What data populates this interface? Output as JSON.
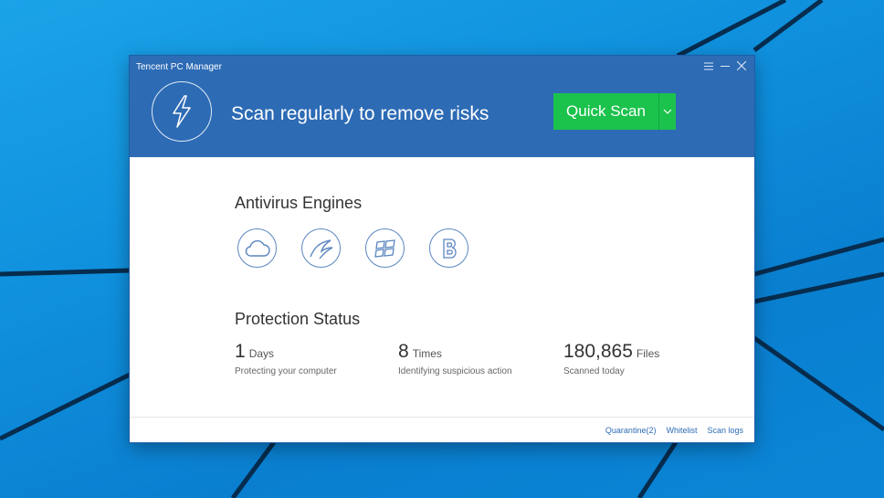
{
  "window": {
    "title": "Tencent PC Manager",
    "controls": [
      "menu-icon",
      "minimize-icon",
      "close-icon"
    ]
  },
  "header": {
    "icon": "lightning-bolt-icon",
    "tagline": "Scan regularly to remove risks",
    "scan_button": "Quick Scan"
  },
  "engines": {
    "title": "Antivirus Engines",
    "items": [
      "cloud-engine-icon",
      "bird-engine-icon",
      "windows-engine-icon",
      "bitdefender-engine-icon"
    ]
  },
  "protection": {
    "title": "Protection Status",
    "stats": [
      {
        "value": "1",
        "unit": "Days",
        "desc": "Protecting your computer"
      },
      {
        "value": "8",
        "unit": "Times",
        "desc": "Identifying suspicious action"
      },
      {
        "value": "180,865",
        "unit": "Files",
        "desc": "Scanned today"
      }
    ]
  },
  "footer": {
    "links": [
      "Quarantine(2)",
      "Whitelist",
      "Scan logs"
    ]
  },
  "colors": {
    "header": "#2d6bb5",
    "scan_button": "#1bc24c",
    "desktop": "#0f8fdc"
  }
}
